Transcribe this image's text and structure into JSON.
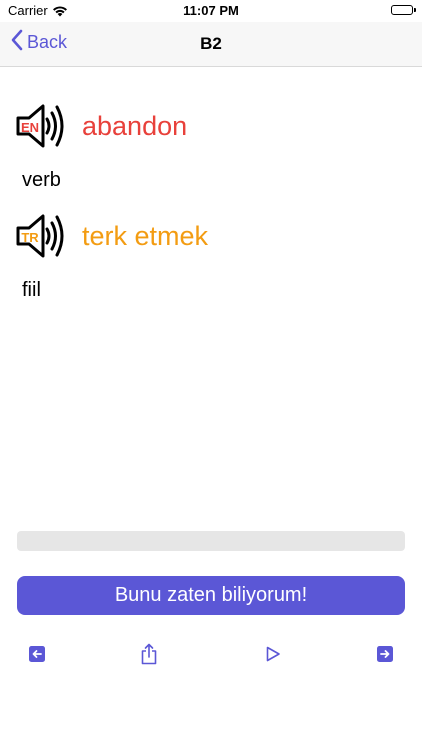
{
  "status_bar": {
    "carrier": "Carrier",
    "time": "11:07 PM"
  },
  "nav": {
    "back_label": "Back",
    "title": "B2"
  },
  "source": {
    "lang_badge": "EN",
    "word": "abandon",
    "part_of_speech": "verb",
    "color": "#e8413b"
  },
  "target": {
    "lang_badge": "TR",
    "word": "terk etmek",
    "part_of_speech": "fiil",
    "color": "#f39c12"
  },
  "progress": {
    "fraction": 0
  },
  "know_button": {
    "label": "Bunu zaten biliyorum!"
  },
  "toolbar": {
    "items": [
      {
        "icon": "arrow-left-square-icon"
      },
      {
        "icon": "share-icon"
      },
      {
        "icon": "play-icon"
      },
      {
        "icon": "arrow-right-square-icon"
      }
    ]
  },
  "accent_color": "#5b57d6"
}
